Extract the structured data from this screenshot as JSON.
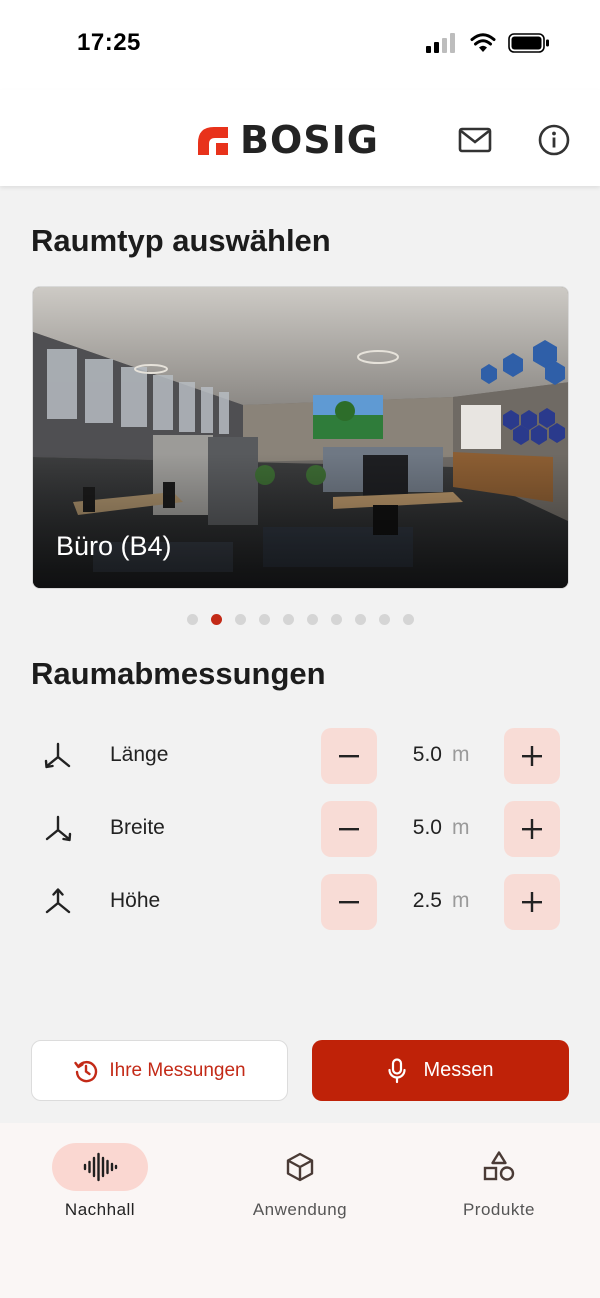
{
  "status_bar": {
    "time": "17:25",
    "icons": [
      "signal-icon",
      "wifi-icon",
      "battery-icon"
    ]
  },
  "header": {
    "logo_text": "BOSIG",
    "icons": [
      "mail-icon",
      "info-icon"
    ],
    "brand_color": "#e8321b"
  },
  "room_type": {
    "title": "Raumtyp auswählen",
    "current_room": "Büro (B4)",
    "total_slides": 10,
    "active_slide": 2
  },
  "dimensions": {
    "title": "Raumabmessungen",
    "rows": [
      {
        "label": "Länge",
        "value": "5.0",
        "unit": "m"
      },
      {
        "label": "Breite",
        "value": "5.0",
        "unit": "m"
      },
      {
        "label": "Höhe",
        "value": "2.5",
        "unit": "m"
      }
    ]
  },
  "actions": {
    "history_label": "Ihre Messungen",
    "measure_label": "Messen",
    "accent_color": "#bf2208"
  },
  "nav": {
    "items": [
      {
        "label": "Nachhall",
        "icon": "soundwave-icon",
        "active": true
      },
      {
        "label": "Anwendung",
        "icon": "cube-icon",
        "active": false
      },
      {
        "label": "Produkte",
        "icon": "shapes-icon",
        "active": false
      }
    ]
  }
}
